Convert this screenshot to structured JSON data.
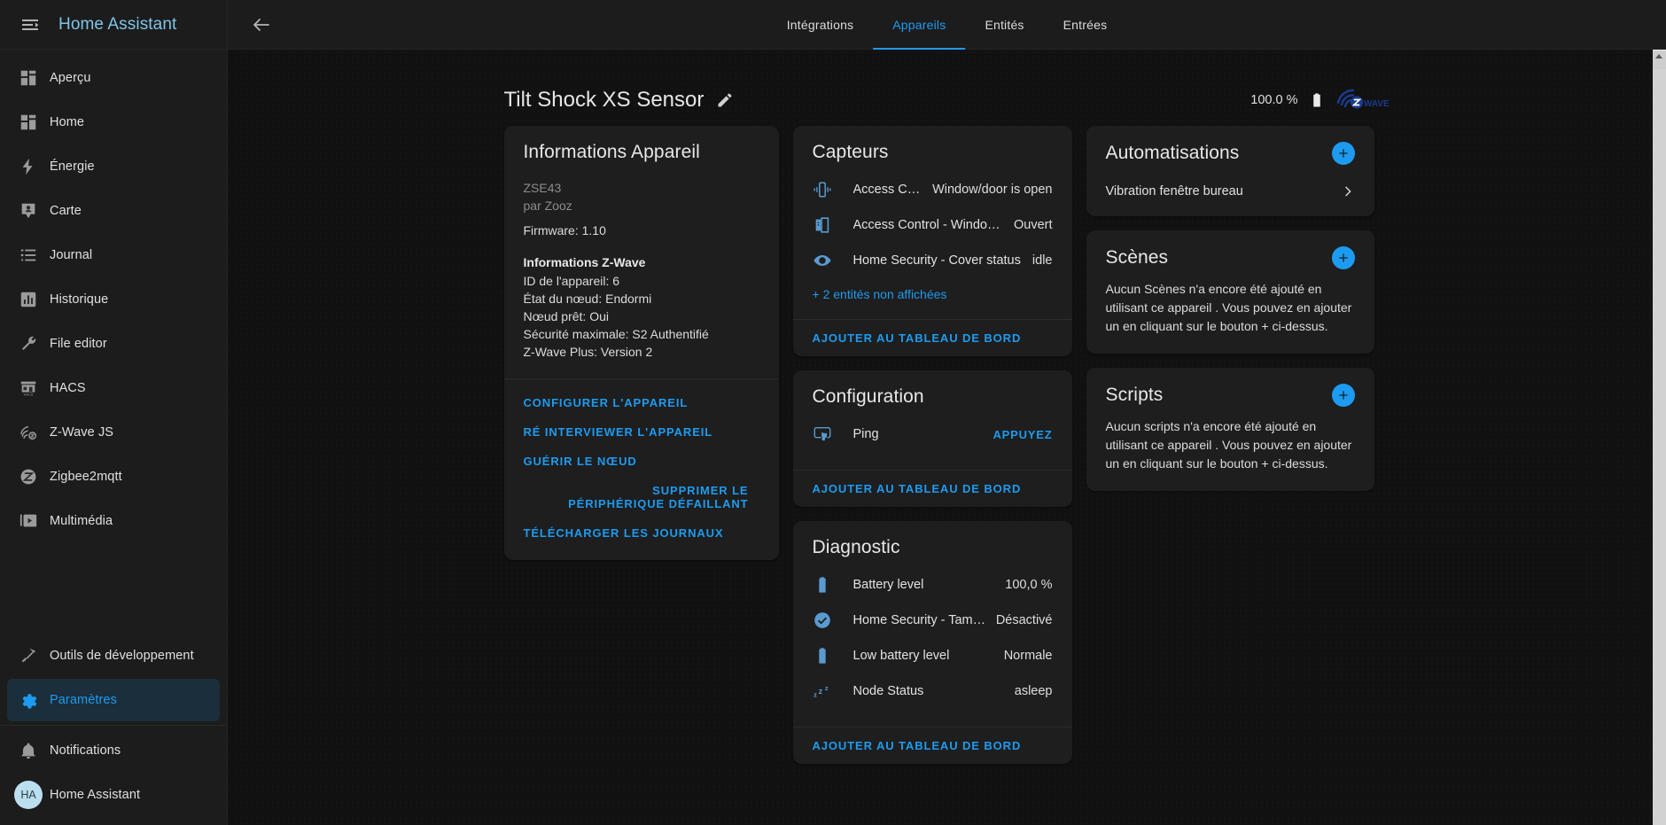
{
  "sidebar": {
    "title": "Home Assistant",
    "menu_icon": "menu-collapse-icon",
    "items": [
      {
        "label": "Aperçu",
        "icon": "view-dashboard-icon"
      },
      {
        "label": "Home",
        "icon": "view-dashboard-icon"
      },
      {
        "label": "Énergie",
        "icon": "lightning-bolt-icon"
      },
      {
        "label": "Carte",
        "icon": "map-marker-account-icon"
      },
      {
        "label": "Journal",
        "icon": "format-list-bulleted-icon"
      },
      {
        "label": "Historique",
        "icon": "chart-box-icon"
      },
      {
        "label": "File editor",
        "icon": "wrench-icon"
      },
      {
        "label": "HACS",
        "icon": "store-icon"
      },
      {
        "label": "Z-Wave JS",
        "icon": "z-wave-icon"
      },
      {
        "label": "Zigbee2mqtt",
        "icon": "zigbee-icon"
      },
      {
        "label": "Multimédia",
        "icon": "play-box-multiple-icon"
      }
    ],
    "bottom_items": [
      {
        "label": "Outils de développement",
        "icon": "hammer-icon",
        "active": false
      },
      {
        "label": "Paramètres",
        "icon": "cog-icon",
        "active": true
      }
    ],
    "footer_items": [
      {
        "label": "Notifications",
        "icon": "bell-icon"
      },
      {
        "label": "Home Assistant",
        "icon": "avatar",
        "initials": "HA"
      }
    ]
  },
  "topbar": {
    "back_icon": "arrow-left-icon",
    "tabs": [
      {
        "label": "Intégrations",
        "active": false
      },
      {
        "label": "Appareils",
        "active": true
      },
      {
        "label": "Entités",
        "active": false
      },
      {
        "label": "Entrées",
        "active": false
      }
    ]
  },
  "page": {
    "title": "Tilt Shock XS Sensor",
    "edit_icon": "pencil-icon",
    "battery_text": "100.0 %",
    "battery_icon": "battery-full-icon",
    "brand_logo": "z-wave-logo",
    "brand_logo_text": "WAVE"
  },
  "device_info": {
    "title": "Informations Appareil",
    "model": "ZSE43",
    "manufacturer": "par Zooz",
    "firmware": "Firmware: 1.10",
    "zwave_heading": "Informations Z-Wave",
    "zwave_lines": [
      "ID de l'appareil: 6",
      "État du nœud: Endormi",
      "Nœud prêt: Oui",
      "Sécurité maximale: S2 Authentifié",
      "Z-Wave Plus: Version 2"
    ],
    "actions": [
      {
        "label": "Configurer l'appareil",
        "indent": false
      },
      {
        "label": "Ré interviewer l'appareil",
        "indent": false
      },
      {
        "label": "Guérir le nœud",
        "indent": false
      },
      {
        "label": "Supprimer le périphérique défaillant",
        "indent": true
      },
      {
        "label": "Télécharger les journaux",
        "indent": false
      }
    ]
  },
  "sensors": {
    "title": "Capteurs",
    "rows": [
      {
        "icon": "vibrate-icon",
        "name": "Access Contr…",
        "value": "Window/door is open"
      },
      {
        "icon": "door-open-icon",
        "name": "Access Control - Window/d…",
        "value": "Ouvert"
      },
      {
        "icon": "eye-icon",
        "name": "Home Security - Cover status",
        "value": "idle"
      }
    ],
    "more_link": "+ 2 entités non affichées",
    "footer_button": "Ajouter au tableau de bord"
  },
  "configuration": {
    "title": "Configuration",
    "rows": [
      {
        "icon": "gesture-tap-button-icon",
        "name": "Ping",
        "value": "Appuyez",
        "is_action": true
      }
    ],
    "footer_button": "Ajouter au tableau de bord"
  },
  "diagnostic": {
    "title": "Diagnostic",
    "rows": [
      {
        "icon": "battery-icon",
        "name": "Battery level",
        "value": "100,0 %"
      },
      {
        "icon": "check-circle-icon",
        "name": "Home Security - Tamperi…",
        "value": "Désactivé"
      },
      {
        "icon": "battery-icon",
        "name": "Low battery level",
        "value": "Normale"
      },
      {
        "icon": "sleep-icon",
        "name": "Node Status",
        "value": "asleep"
      }
    ],
    "footer_button": "Ajouter au tableau de bord"
  },
  "automations": {
    "title": "Automatisations",
    "add_icon": "plus-circle-icon",
    "items": [
      {
        "label": "Vibration fenêtre bureau",
        "chevron": "chevron-right-icon"
      }
    ]
  },
  "scenes": {
    "title": "Scènes",
    "add_icon": "plus-circle-icon",
    "empty_text": "Aucun Scènes n'a encore été ajouté en utilisant ce appareil . Vous pouvez en ajouter un en cliquant sur le bouton + ci-dessus."
  },
  "scripts": {
    "title": "Scripts",
    "add_icon": "plus-circle-icon",
    "empty_text": "Aucun scripts n'a encore été ajouté en utilisant ce appareil . Vous pouvez en ajouter un en cliquant sur le bouton + ci-dessus."
  },
  "colors": {
    "accent": "#1d9bf0",
    "page_bg": "#111111",
    "card_bg": "#1e1e1e",
    "sidebar_bg": "#1c1c1c",
    "icon_blue": "#5b9ad1",
    "brand_blue": "#1b3a8c"
  }
}
